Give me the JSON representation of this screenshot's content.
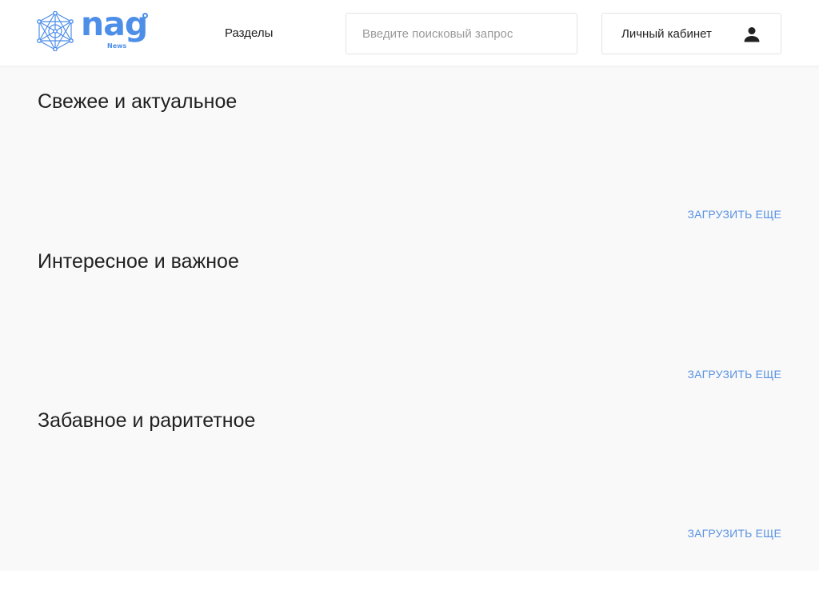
{
  "header": {
    "logo": {
      "word": "nag",
      "subtitle": "News",
      "color": "#4d8ee8"
    },
    "nav": {
      "sections_label": "Разделы"
    },
    "search": {
      "placeholder": "Введите поисковый запрос",
      "value": ""
    },
    "account": {
      "label": "Личный кабинет",
      "icon": "person-icon"
    }
  },
  "sections": [
    {
      "title": "Свежее и актуальное",
      "load_more_label": "ЗАГРУЗИТЬ ЕЩЕ"
    },
    {
      "title": "Интересное и важное",
      "load_more_label": "ЗАГРУЗИТЬ ЕЩЕ"
    },
    {
      "title": "Забавное и раритетное",
      "load_more_label": "ЗАГРУЗИТЬ ЕЩЕ"
    }
  ],
  "colors": {
    "accent": "#4d8ee8",
    "link": "#5b93e3",
    "background": "#f9f9f9"
  }
}
